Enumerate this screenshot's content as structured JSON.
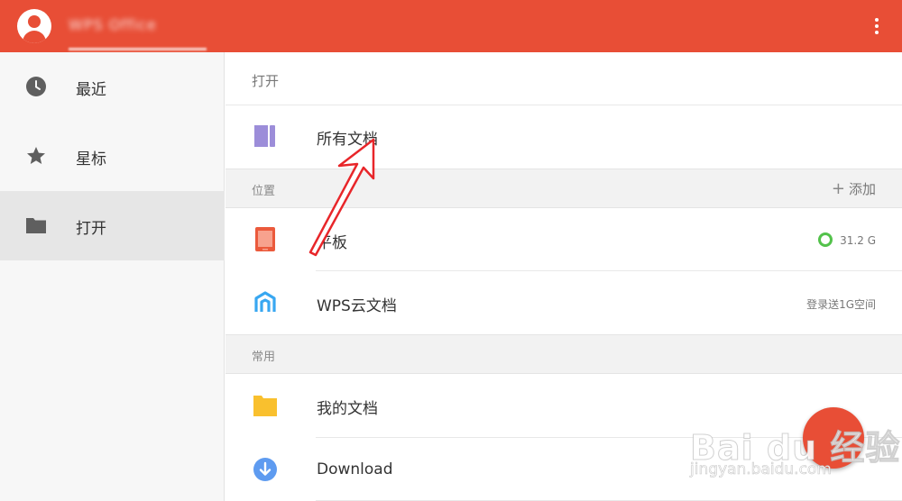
{
  "header": {
    "account_name": "WPS Office",
    "menu_icon": "more-vertical-icon",
    "brand_color": "#E84E36"
  },
  "sidebar": {
    "items": [
      {
        "label": "最近",
        "icon": "clock-icon"
      },
      {
        "label": "星标",
        "icon": "star-icon"
      },
      {
        "label": "打开",
        "icon": "folder-icon",
        "active": true
      }
    ]
  },
  "main": {
    "open_header": "打开",
    "all_docs": {
      "label": "所有文档",
      "icon": "document-book-icon"
    },
    "location_section": {
      "title": "位置",
      "add_label": "添加"
    },
    "tablet": {
      "label": "平板",
      "storage": "31.2 G",
      "icon": "tablet-icon"
    },
    "cloud": {
      "label": "WPS云文档",
      "note": "登录送1G空间",
      "icon": "wps-cloud-icon"
    },
    "common_section": {
      "title": "常用"
    },
    "my_docs": {
      "label": "我的文档",
      "icon": "yellow-folder-icon"
    },
    "download": {
      "label": "Download",
      "icon": "download-icon"
    }
  },
  "watermark": {
    "brand": "Bai du 经验",
    "url": "jingyan.baidu.com"
  },
  "colors": {
    "accent": "#E84E36",
    "storage_ok": "#53C24B",
    "folder_yellow": "#F9C02E",
    "download_blue": "#5E9BF0",
    "cloud_blue": "#38A7F1",
    "doc_purple": "#9C8DD9"
  }
}
